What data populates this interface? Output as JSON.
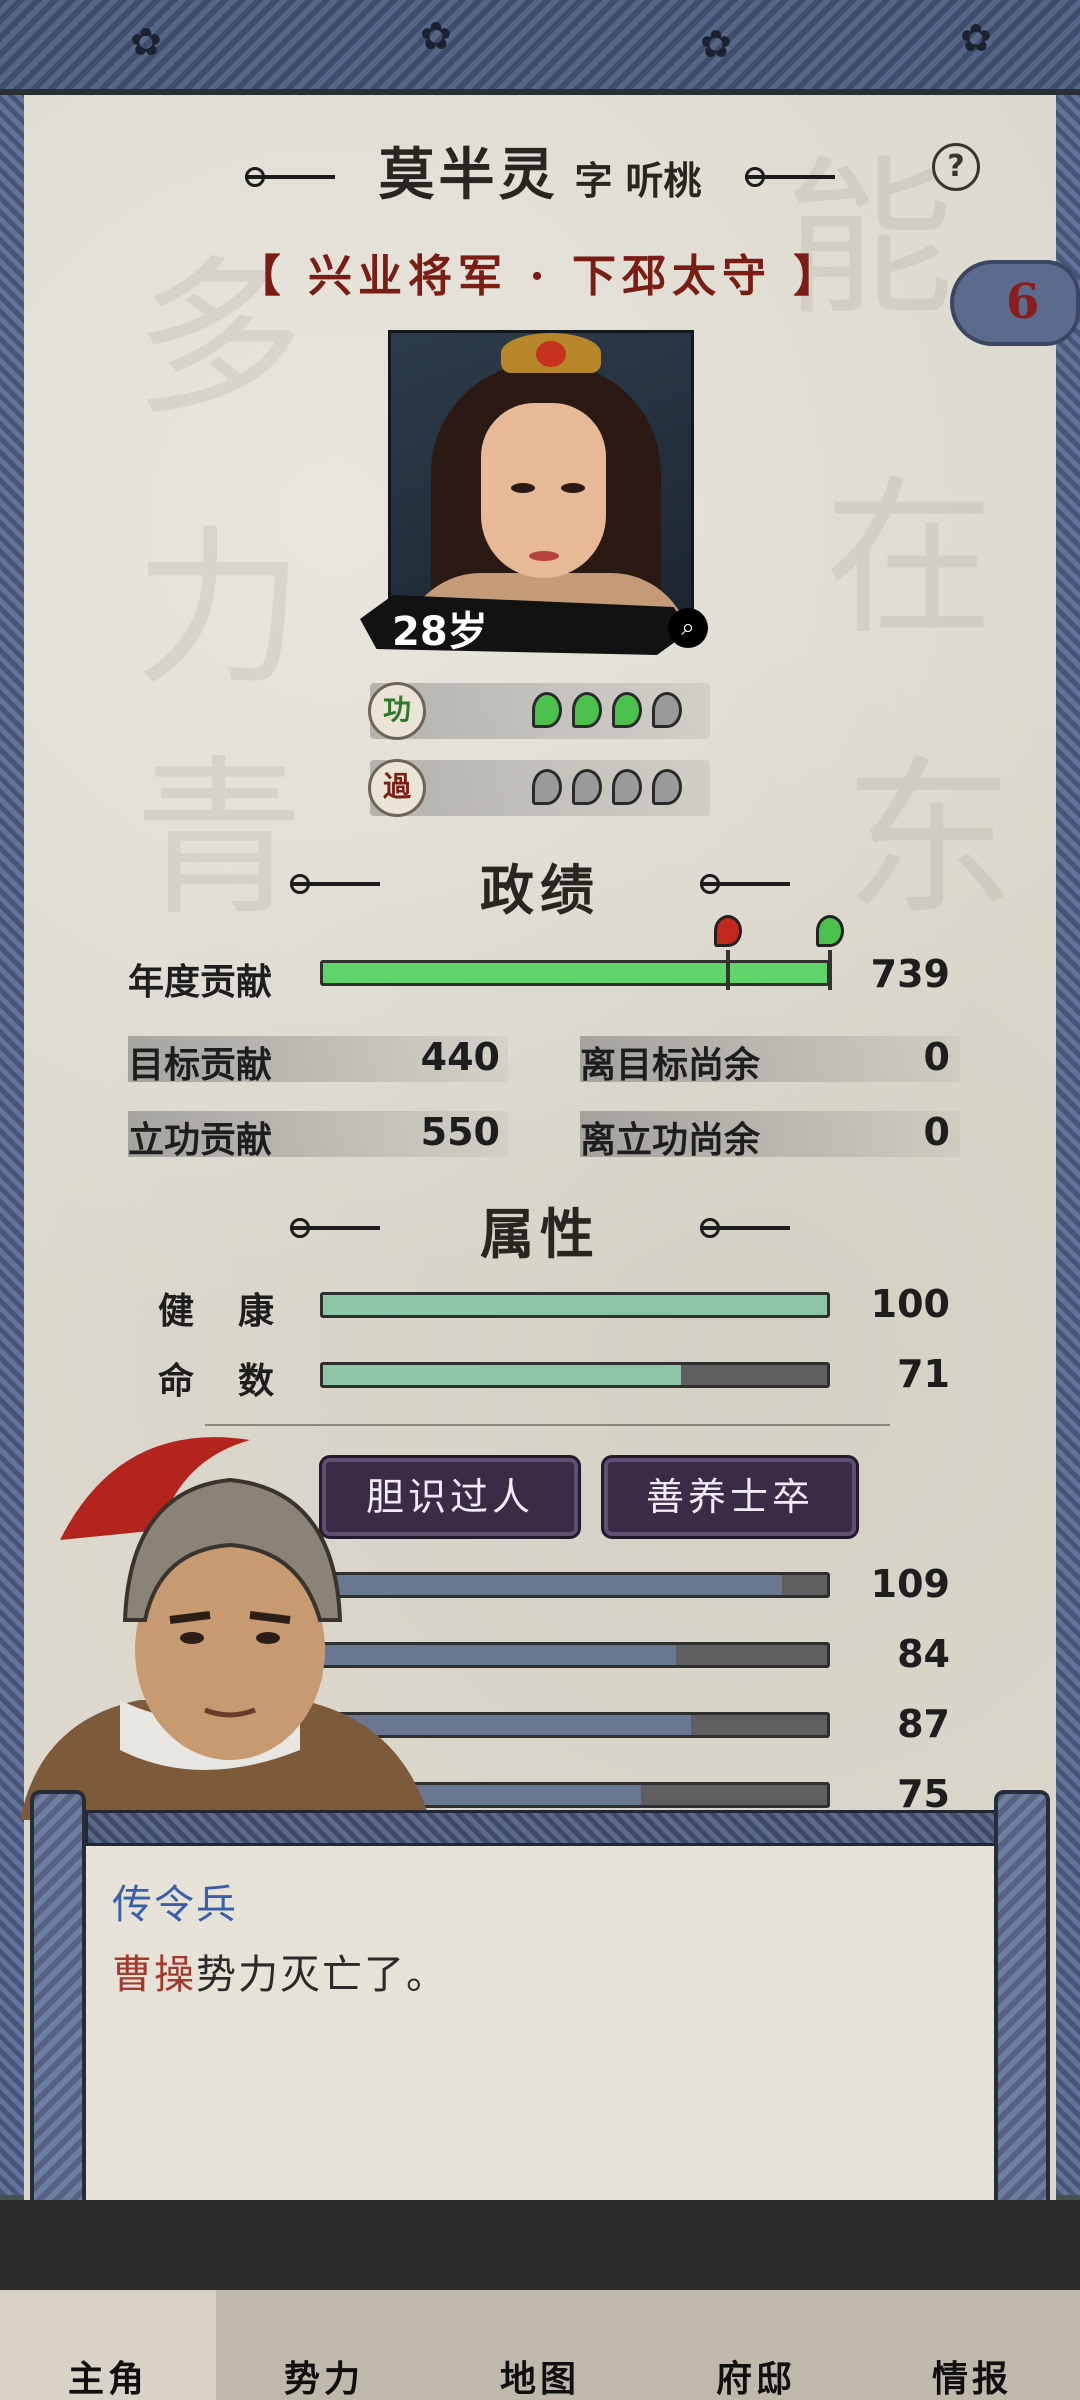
{
  "character": {
    "name": "莫半灵",
    "zi_label": "字",
    "courtesy_name": "听桃",
    "office": "【 兴业将军 · 下邳太守 】",
    "age": "28岁",
    "badge_count": "6",
    "merit_label": "功",
    "fault_label": "過",
    "merit_icons": [
      "green",
      "green",
      "green",
      "gray"
    ],
    "fault_icons": [
      "gray",
      "gray",
      "gray",
      "gray"
    ]
  },
  "performance": {
    "title": "政绩",
    "annual_label": "年度贡献",
    "annual_value": "739",
    "annual_fill_fraction": 1.0,
    "target_marker_fraction": 0.8,
    "merit_marker_fraction": 1.0,
    "rows": [
      {
        "label": "目标贡献",
        "value": "440",
        "label2": "离目标尚余",
        "value2": "0"
      },
      {
        "label": "立功贡献",
        "value": "550",
        "label2": "离立功尚余",
        "value2": "0"
      }
    ]
  },
  "attributes": {
    "title": "属性",
    "stats": [
      {
        "label": "健　康",
        "value": "100",
        "fraction": 1.0
      },
      {
        "label": "命　数",
        "value": "71",
        "fraction": 0.71
      }
    ],
    "traits": [
      "胆识过人",
      "善养士卒"
    ],
    "abilities": [
      {
        "value": "109",
        "fraction": 0.91
      },
      {
        "value": "84",
        "fraction": 0.7
      },
      {
        "value": "87",
        "fraction": 0.73
      },
      {
        "value": "75",
        "fraction": 0.63
      }
    ]
  },
  "dialog": {
    "speaker": "传令兵",
    "message_highlight": "曹操",
    "message_rest": "势力灭亡了。"
  },
  "nav": {
    "tabs": [
      "主角",
      "势力",
      "地图",
      "府邸",
      "情报"
    ]
  },
  "colors": {
    "annual_bar": "#5fd46a",
    "stat_bar": "#8ec5a8",
    "ability_bar": "#6a7791",
    "office_text": "#7a1d14",
    "speaker_text": "#3a5fa8",
    "highlight_text": "#a33a30",
    "trait_bg": "#3a2c46"
  }
}
